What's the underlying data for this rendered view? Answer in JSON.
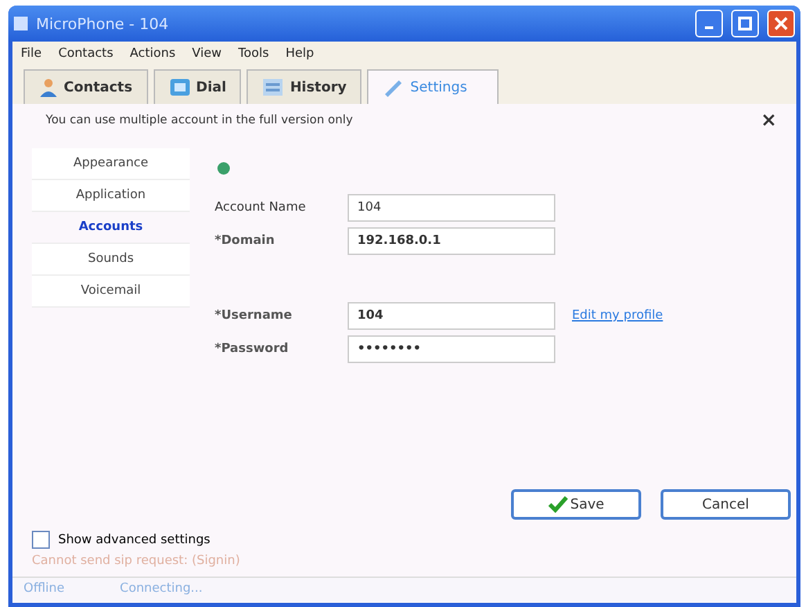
{
  "window": {
    "title": "MicroPhone - 104"
  },
  "menu": [
    "File",
    "Contacts",
    "Actions",
    "View",
    "Tools",
    "Help"
  ],
  "tabs": [
    {
      "label": "Contacts",
      "kind": "contacts",
      "selected": false
    },
    {
      "label": "Dial",
      "kind": "dial",
      "selected": false
    },
    {
      "label": "History",
      "kind": "history",
      "selected": false
    },
    {
      "label": "Settings",
      "kind": "settings",
      "selected": true
    }
  ],
  "notice": {
    "text": "You can use multiple account in the full version only",
    "close": "×"
  },
  "sidebar": {
    "items": [
      {
        "label": "Appearance",
        "selected": false
      },
      {
        "label": "Application",
        "selected": false
      },
      {
        "label": "Accounts",
        "selected": true
      },
      {
        "label": "Sounds",
        "selected": false
      },
      {
        "label": "Voicemail",
        "selected": false
      }
    ]
  },
  "form": {
    "account_fields": [
      {
        "label": "Account Name",
        "value": "104",
        "required": false
      },
      {
        "label": "*Domain",
        "value": "192.168.0.1",
        "required": true
      }
    ],
    "login_fields": [
      {
        "label": "*Username",
        "value": "104",
        "required": true
      },
      {
        "label": "*Password",
        "value": "••••••••",
        "required": true
      }
    ],
    "link": "Edit my profile"
  },
  "buttons": [
    {
      "label": "Save",
      "kind": "primary"
    },
    {
      "label": "Cancel",
      "kind": "secondary"
    }
  ],
  "advanced": {
    "label": "Show advanced settings",
    "checked": false
  },
  "error": "Cannot send sip request: (Signin)",
  "status_bar": {
    "state": "Offline",
    "message": "Connecting..."
  }
}
